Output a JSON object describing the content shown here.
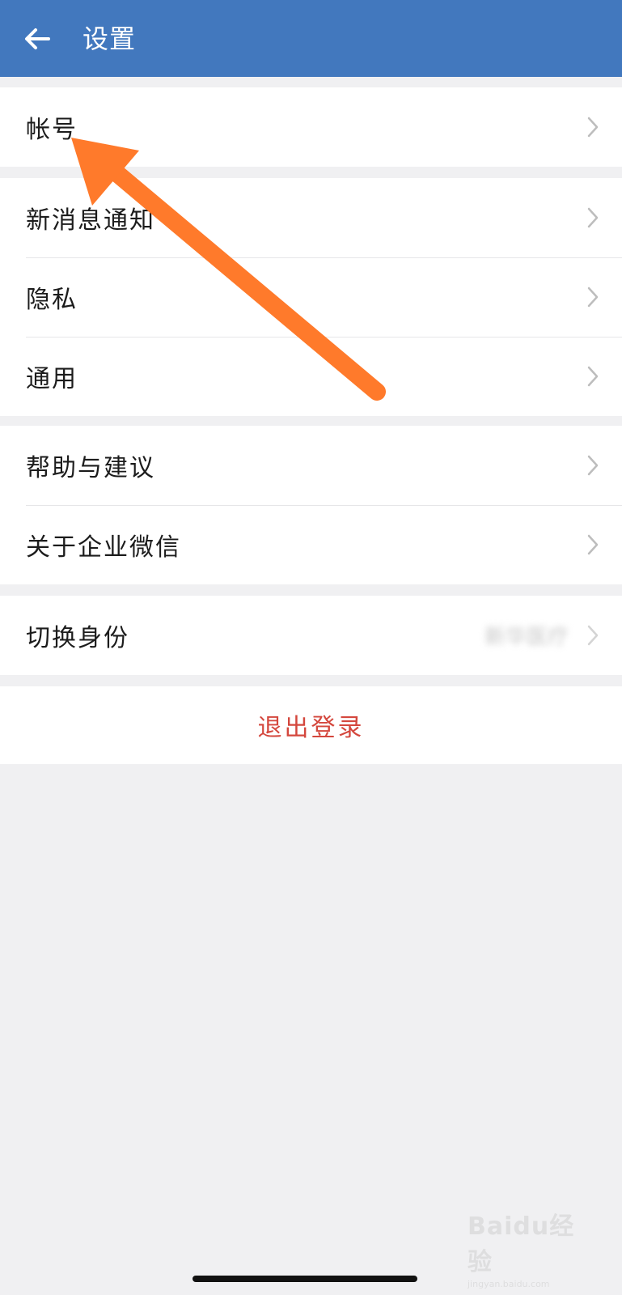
{
  "header": {
    "title": "设置",
    "back_icon": "arrow-left-icon",
    "background": "#4278be"
  },
  "groups": [
    {
      "items": [
        {
          "label": "帐号"
        }
      ]
    },
    {
      "items": [
        {
          "label": "新消息通知"
        },
        {
          "label": "隐私"
        },
        {
          "label": "通用"
        }
      ]
    },
    {
      "items": [
        {
          "label": "帮助与建议"
        },
        {
          "label": "关于企业微信"
        }
      ]
    },
    {
      "items": [
        {
          "label": "切换身份",
          "value": "新华医疗"
        }
      ]
    }
  ],
  "logout": {
    "label": "退出登录",
    "color": "#d4473d"
  },
  "annotation": {
    "type": "orange-arrow-pointing-to-account",
    "color": "#ff7a2b"
  },
  "watermark": {
    "main": "Baidu经验",
    "sub": "jingyan.baidu.com"
  }
}
